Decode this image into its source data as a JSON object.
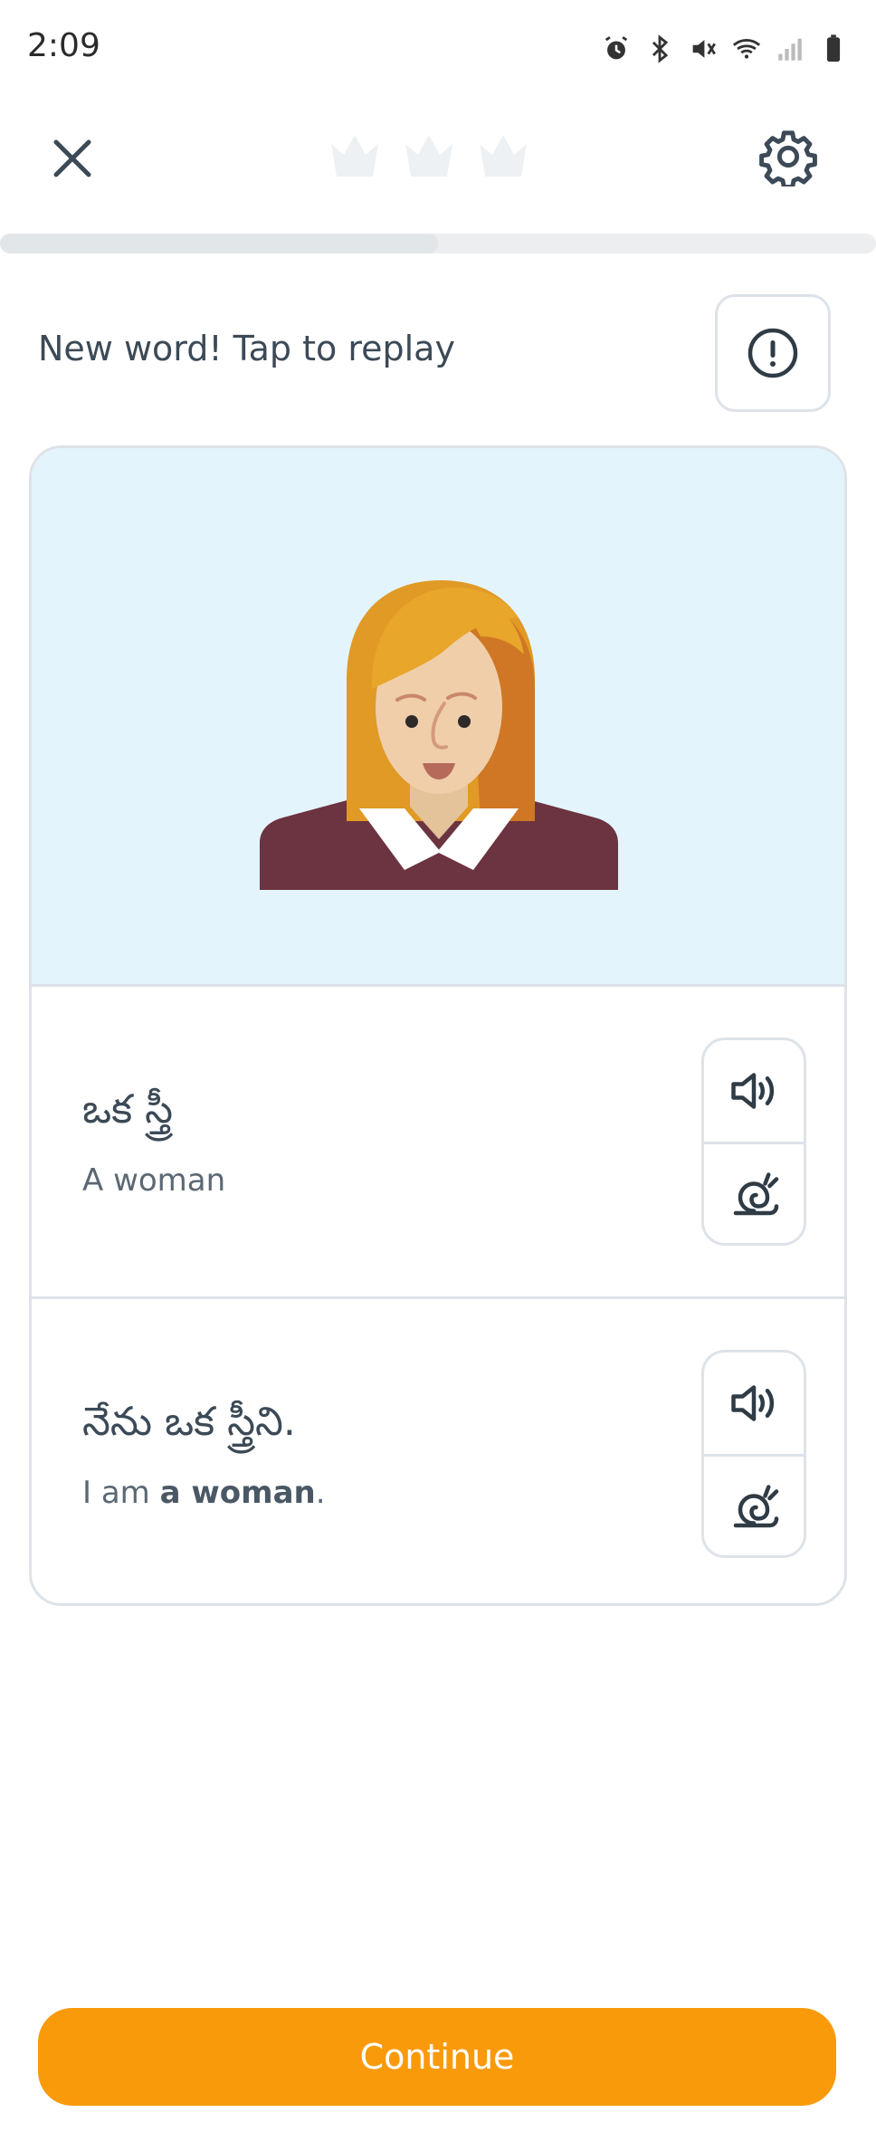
{
  "status_bar": {
    "time": "2:09",
    "icons": [
      "alarm-icon",
      "bluetooth-icon",
      "mute-icon",
      "wifi-icon",
      "signal-icon",
      "battery-icon"
    ]
  },
  "header": {
    "close_icon": "close-icon",
    "crowns": [
      "crown-icon",
      "crown-icon",
      "crown-icon"
    ],
    "settings_icon": "gear-icon",
    "progress_fraction": 0.5
  },
  "prompt": {
    "text": "New word! Tap to replay",
    "report_icon": "alert-circle-icon"
  },
  "card": {
    "illustration": "woman-illustration",
    "rows": [
      {
        "native": "ఒక స్త్రీ",
        "translation_plain": "A woman",
        "audio_icon": "speaker-icon",
        "slow_icon": "snail-icon"
      },
      {
        "native": "నేను ఒక స్త్రీని.",
        "translation_prefix": "I am ",
        "translation_bold": "a woman",
        "translation_suffix": ".",
        "audio_icon": "speaker-icon",
        "slow_icon": "snail-icon"
      }
    ]
  },
  "footer": {
    "continue_label": "Continue"
  },
  "colors": {
    "accent": "#f99a0b",
    "image_bg": "#e4f4fc",
    "border": "#dde3e8",
    "text": "#3c4a57"
  }
}
